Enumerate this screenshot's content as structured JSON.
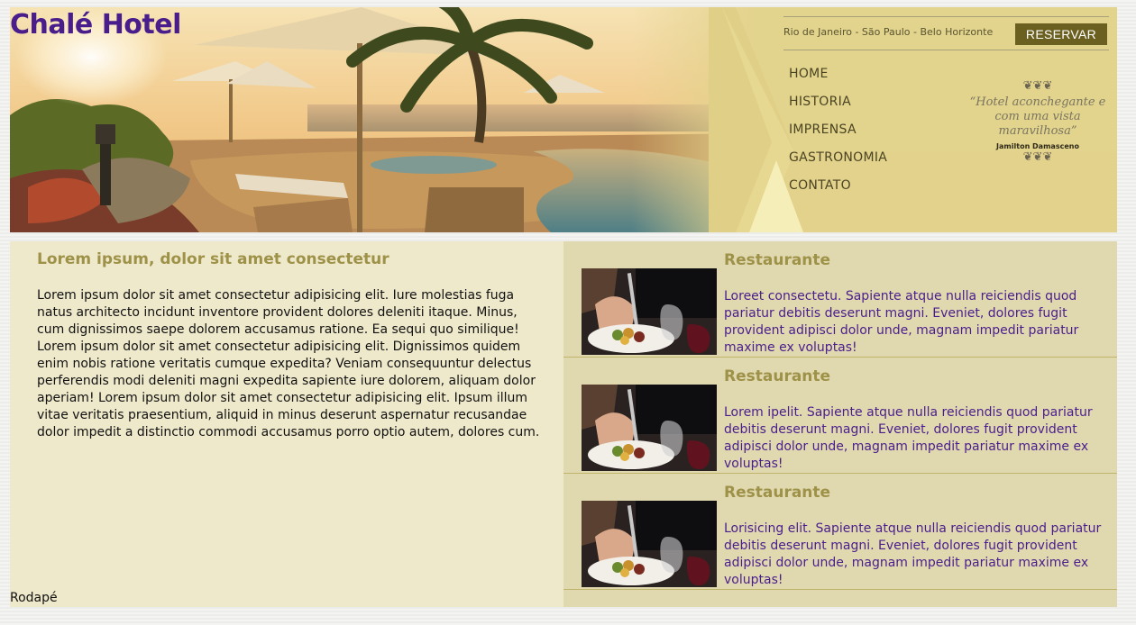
{
  "header": {
    "brand": "Chalé Hotel",
    "cities": "Rio de Janeiro - São Paulo - Belo Horizonte",
    "reserve_label": "RESERVAR",
    "nav": [
      "HOME",
      "HISTORIA",
      "IMPRENSA",
      "GASTRONOMIA",
      "CONTATO"
    ],
    "quote": {
      "text": "“Hotel aconchegante e com uma vista maravilhosa”",
      "author": "Jamilton Damasceno"
    }
  },
  "main": {
    "title": "Lorem ipsum, dolor sit amet consectetur",
    "body": "Lorem ipsum dolor sit amet consectetur adipisicing elit. Iure molestias fuga natus architecto incidunt inventore provident dolores deleniti itaque. Minus, cum dignissimos saepe dolorem accusamus ratione. Ea sequi quo similique! Lorem ipsum dolor sit amet consectetur adipisicing elit. Dignissimos quidem enim nobis ratione veritatis cumque expedita? Veniam consequuntur delectus perferendis modi deleniti magni expedita sapiente iure dolorem, aliquam dolor aperiam! Lorem ipsum dolor sit amet consectetur adipisicing elit. Ipsum illum vitae veritatis praesentium, aliquid in minus deserunt aspernatur recusandae dolor impedit a distinctio commodi accusamus porro optio autem, dolores cum."
  },
  "restaurants": [
    {
      "title": "Restaurante",
      "text": "Loreet consectetu. Sapiente atque nulla reiciendis quod pariatur debitis deserunt magni. Eveniet, dolores fugit provident adipisci dolor unde, magnam impedit pariatur maxime ex voluptas!"
    },
    {
      "title": "Restaurante",
      "text": "Lorem ipelit. Sapiente atque nulla reiciendis quod pariatur debitis deserunt magni. Eveniet, dolores fugit provident adipisci dolor unde, magnam impedit pariatur maxime ex voluptas!"
    },
    {
      "title": "Restaurante",
      "text": "Lorisicing elit. Sapiente atque nulla reiciendis quod pariatur debitis deserunt magni. Eveniet, dolores fugit provident adipisci dolor unde, magnam impedit pariatur maxime ex voluptas!"
    }
  ],
  "footer": "Rodapé",
  "colors": {
    "brand": "#4a1d8c",
    "heading": "#9e9148",
    "button": "#6b6020",
    "left_panel": "#efe9cb",
    "right_panel": "#e0d9b0"
  }
}
